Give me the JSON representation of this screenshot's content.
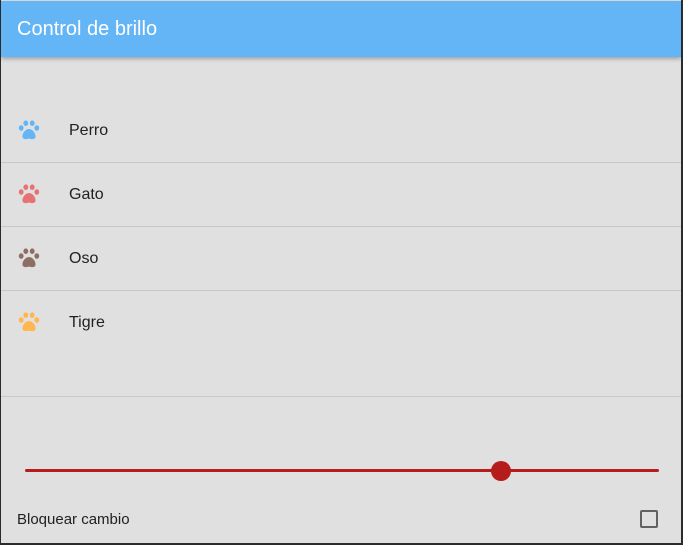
{
  "app": {
    "title": "Control de brillo",
    "accent_color": "#64b5f6"
  },
  "animals": [
    {
      "label": "Perro",
      "icon": "paw-icon",
      "color": "#64b5f6"
    },
    {
      "label": "Gato",
      "icon": "paw-icon",
      "color": "#e57373"
    },
    {
      "label": "Oso",
      "icon": "paw-icon",
      "color": "#8d6e63"
    },
    {
      "label": "Tigre",
      "icon": "paw-icon",
      "color": "#ffb74d"
    }
  ],
  "brightness_slider": {
    "value": 0.75,
    "color": "#b71c1c"
  },
  "lock": {
    "label": "Bloquear cambio",
    "checked": false
  }
}
